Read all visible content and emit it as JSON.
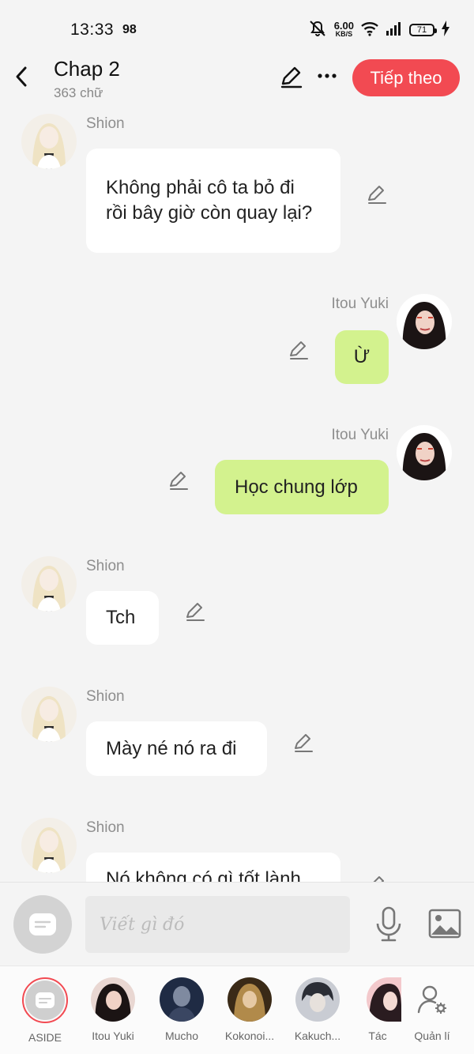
{
  "status_bar": {
    "time": "13:33",
    "badge": "98",
    "net_speed_value": "6.00",
    "net_speed_unit": "KB/S",
    "battery": "71"
  },
  "header": {
    "title": "Chap 2",
    "subtitle": "363 chữ",
    "next_label": "Tiếp theo",
    "accent_color": "#f24a52"
  },
  "messages": [
    {
      "sender": "Shion",
      "side": "left",
      "text": "Không phải cô ta bỏ đi rồi bây giờ còn quay lại?"
    },
    {
      "sender": "Itou Yuki",
      "side": "right",
      "text": "Ừ"
    },
    {
      "sender": "Itou Yuki",
      "side": "right",
      "text": "Học chung lớp"
    },
    {
      "sender": "Shion",
      "side": "left",
      "text": "Tch"
    },
    {
      "sender": "Shion",
      "side": "left",
      "text": "Mày né nó ra đi"
    },
    {
      "sender": "Shion",
      "side": "left",
      "text": "Nó không có gì tốt lành"
    }
  ],
  "input": {
    "placeholder": "Viết gì đó"
  },
  "characters": [
    {
      "label": "ASIDE"
    },
    {
      "label": "Itou Yuki"
    },
    {
      "label": "Mucho"
    },
    {
      "label": "Kokonoi..."
    },
    {
      "label": "Kakuch..."
    },
    {
      "label": "Tác"
    },
    {
      "label": "Quản lí"
    }
  ],
  "colors": {
    "left_bubble": "#ffffff",
    "right_bubble": "#d3f28e",
    "background": "#f4f4f4"
  }
}
